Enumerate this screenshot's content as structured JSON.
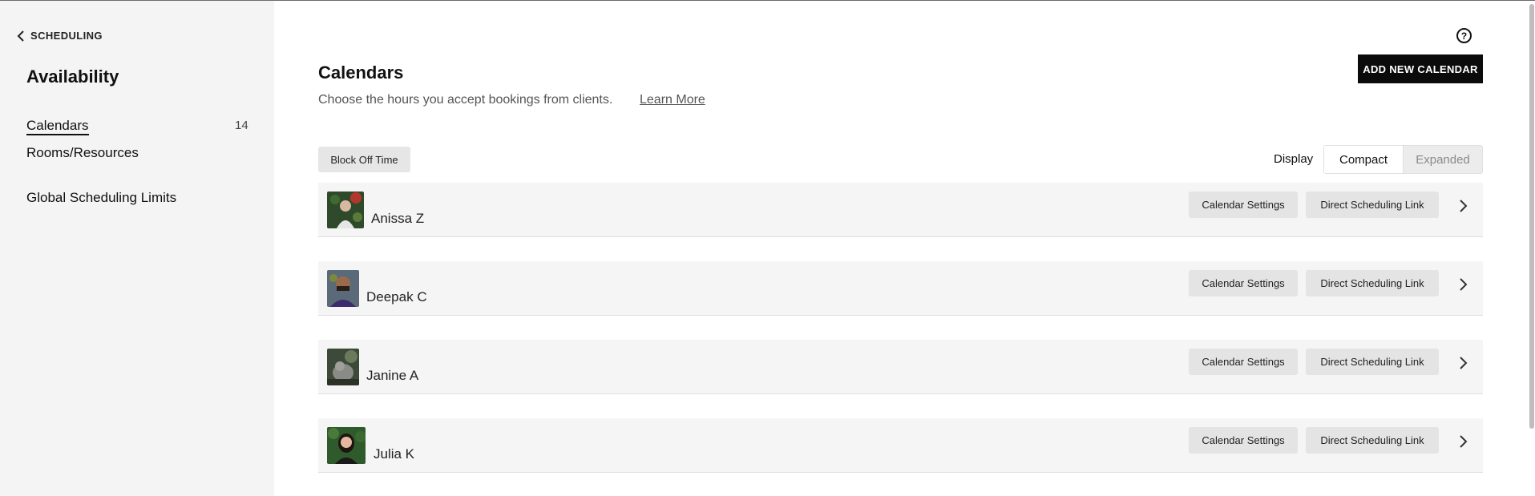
{
  "sidebar": {
    "back_label": "SCHEDULING",
    "title": "Availability",
    "items": [
      {
        "label": "Calendars",
        "count": "14"
      },
      {
        "label": "Rooms/Resources"
      },
      {
        "label": "Global Scheduling Limits"
      }
    ]
  },
  "header": {
    "title": "Calendars",
    "subtitle": "Choose the hours you accept bookings from clients.",
    "learn_more": "Learn More",
    "add_button": "ADD NEW CALENDAR",
    "help_icon": "question-circle-icon"
  },
  "toolbar": {
    "block_off": "Block Off Time",
    "display_label": "Display",
    "display_options": [
      "Compact",
      "Expanded"
    ],
    "display_selected": "Compact"
  },
  "calendars": [
    {
      "name": "Anissa Z",
      "settings": "Calendar Settings",
      "link": "Direct Scheduling Link"
    },
    {
      "name": "Deepak C",
      "settings": "Calendar Settings",
      "link": "Direct Scheduling Link"
    },
    {
      "name": "Janine A",
      "settings": "Calendar Settings",
      "link": "Direct Scheduling Link"
    },
    {
      "name": "Julia K",
      "settings": "Calendar Settings",
      "link": "Direct Scheduling Link"
    }
  ],
  "colors": {
    "sidebar_bg": "#f4f4f4",
    "row_bg": "#f5f5f5",
    "primary_button": "#0b0b0b"
  }
}
